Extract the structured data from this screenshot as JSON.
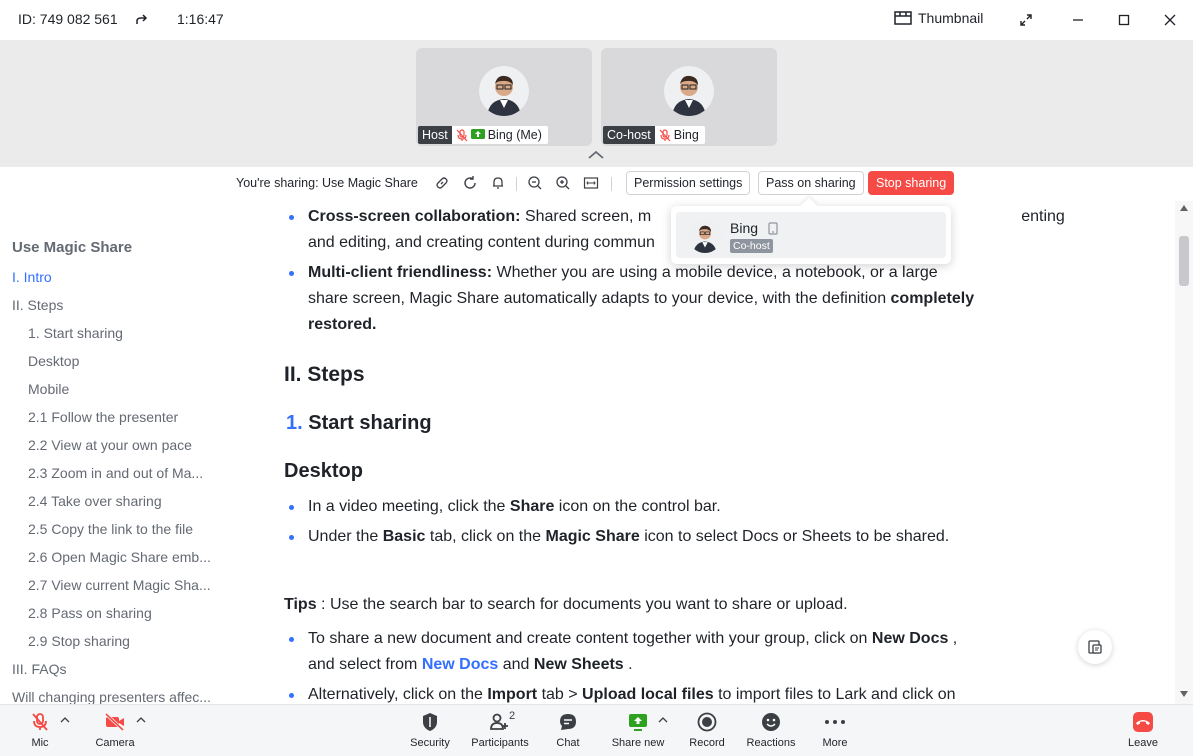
{
  "titlebar": {
    "meeting_id": "ID: 749 082 561",
    "timer": "1:16:47",
    "thumbnail_label": "Thumbnail"
  },
  "videos": [
    {
      "role": "Host",
      "name": "Bing (Me)"
    },
    {
      "role": "Co-host",
      "name": "Bing"
    }
  ],
  "sharebar": {
    "sharing_text": "You're sharing: Use Magic Share",
    "permission_settings": "Permission settings",
    "pass_on_sharing": "Pass on sharing",
    "stop_sharing": "Stop sharing"
  },
  "popover": {
    "name": "Bing",
    "badge": "Co-host"
  },
  "toc": {
    "title": "Use Magic Share",
    "items": [
      "I. Intro",
      "II. Steps",
      "1. Start sharing",
      "Desktop",
      "Mobile",
      "2.1 Follow the presenter",
      "2.2 View at your own pace",
      "2.3 Zoom in and out of Ma...",
      "2.4 Take over sharing",
      "2.5 Copy the link to the file",
      "2.6 Open Magic Share emb...",
      "2.7 View current Magic Sha...",
      "2.8 Pass on sharing",
      "2.9 Stop sharing",
      "III. FAQs",
      "Will changing presenters affec..."
    ]
  },
  "doc": {
    "b1_bold": "Cross-screen collaboration:",
    "b1_text_a": " Shared screen, m",
    "b1_text_b": "enting",
    "b1_line2": "and editing, and creating content during commun",
    "b2_bold": "Multi-client friendliness:",
    "b2_text": " Whether you are using a mobile device, a notebook, or a large",
    "b2_line2": "share screen, Magic Share automatically adapts to your device, with the definition ",
    "b2_line2_bold": "completely",
    "b2_line3_bold": "restored.",
    "h_steps": "II. Steps",
    "h_start_num": "1.",
    "h_start": "Start sharing",
    "h_desktop": "Desktop",
    "d1_a": "In a video meeting, click the ",
    "d1_b": "Share",
    "d1_c": " icon on the control bar.",
    "d2_a": "Under the ",
    "d2_b": "Basic",
    "d2_c": " tab, click on the ",
    "d2_d": "Magic Share",
    "d2_e": " icon to select Docs or Sheets to be shared.",
    "tips_b": "Tips",
    "tips_t": " : Use the search bar to search for documents you want to share or upload.",
    "t1_a": "To share a new document and create content together with your group, click on ",
    "t1_b": "New Docs",
    "t1_c": " ,",
    "t1_d": "and select from ",
    "t1_e": "New Docs",
    "t1_f": " and ",
    "t1_g": "New Sheets",
    "t1_h": " .",
    "t2_a": "Alternatively, click on the ",
    "t2_b": "Import",
    "t2_c": " tab > ",
    "t2_d": "Upload local files",
    "t2_e": " to import files to Lark and click on"
  },
  "toolbar": {
    "mic": "Mic",
    "camera": "Camera",
    "security": "Security",
    "participants": "Participants",
    "participants_count": "2",
    "chat": "Chat",
    "share_new": "Share new",
    "record": "Record",
    "reactions": "Reactions",
    "more": "More",
    "leave": "Leave"
  },
  "colors": {
    "accent": "#3370ff",
    "stop": "#f54a45",
    "share_green": "#2ea121"
  }
}
